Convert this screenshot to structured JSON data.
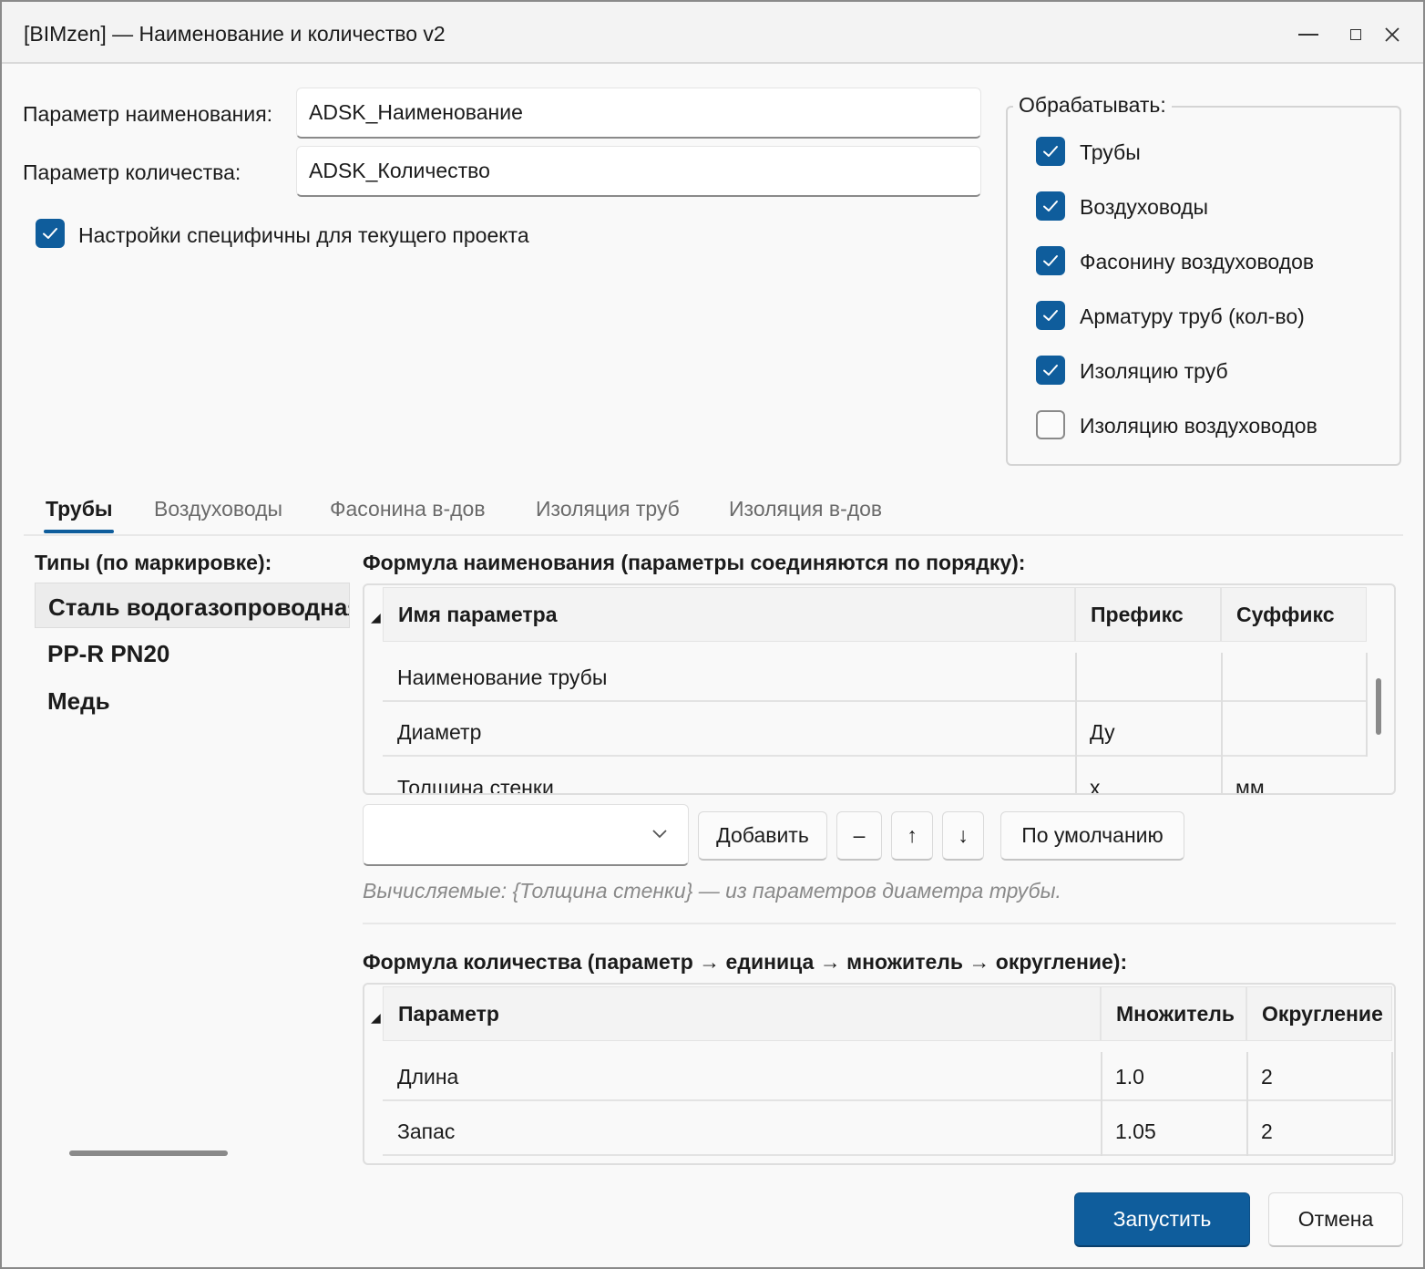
{
  "window": {
    "title": "[BIMzen] — Наименование и количество v2"
  },
  "params": {
    "name_label": "Параметр наименования:",
    "name_value": "ADSK_Наименование",
    "qty_label": "Параметр количества:",
    "qty_value": "ADSK_Количество",
    "project_specific_label": "Настройки специфичны для текущего проекта",
    "project_specific_checked": true
  },
  "process": {
    "title": "Обрабатывать:",
    "items": [
      {
        "label": "Трубы",
        "checked": true
      },
      {
        "label": "Воздуховоды",
        "checked": true
      },
      {
        "label": "Фасонину воздуховодов",
        "checked": true
      },
      {
        "label": "Арматуру труб (кол-во)",
        "checked": true
      },
      {
        "label": "Изоляцию труб",
        "checked": true
      },
      {
        "label": "Изоляцию воздуховодов",
        "checked": false
      }
    ]
  },
  "tabs": [
    {
      "label": "Трубы",
      "active": true
    },
    {
      "label": "Воздуховоды",
      "active": false
    },
    {
      "label": "Фасонина в-дов",
      "active": false
    },
    {
      "label": "Изоляция труб",
      "active": false
    },
    {
      "label": "Изоляция в-дов",
      "active": false
    }
  ],
  "types": {
    "title": "Типы (по маркировке):",
    "items": [
      "Сталь водогазопроводная",
      "PP-R PN20",
      "Медь"
    ],
    "selected_index": 0
  },
  "name_formula": {
    "title": "Формула наименования (параметры соединяются по порядку):",
    "columns": [
      "Имя параметра",
      "Префикс",
      "Суффикс"
    ],
    "rows": [
      [
        "Наименование трубы",
        "",
        ""
      ],
      [
        "Диаметр",
        "Ду",
        ""
      ],
      [
        "Толщина стенки",
        "х",
        "мм"
      ]
    ],
    "combo_value": "",
    "add_label": "Добавить",
    "remove_label": "–",
    "up_label": "↑",
    "down_label": "↓",
    "default_label": "По умолчанию",
    "hint": "Вычисляемые: {Толщина стенки} — из параметров диаметра трубы."
  },
  "qty_formula": {
    "title": "Формула количества (параметр → единица → множитель → округление):",
    "columns": [
      "Параметр",
      "Множитель",
      "Округление"
    ],
    "rows": [
      [
        "Длина",
        "1.0",
        "2"
      ],
      [
        "Запас",
        "1.05",
        "2"
      ]
    ]
  },
  "footer": {
    "run_label": "Запустить",
    "cancel_label": "Отмена"
  },
  "colors": {
    "accent": "#0f5d9c"
  },
  "icons": {
    "minimize": "minimize-icon",
    "maximize": "maximize-icon",
    "close": "close-icon",
    "check": "check-icon",
    "chevron": "chevron-down-icon"
  }
}
